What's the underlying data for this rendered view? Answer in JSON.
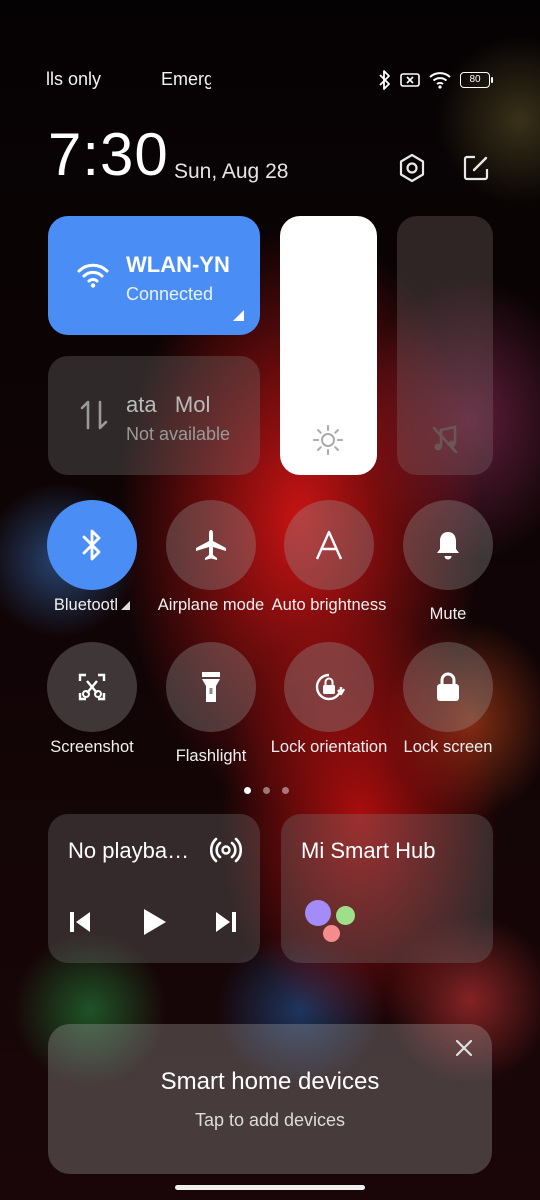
{
  "status_bar": {
    "operator_1": "lls only",
    "operator_2": "Emerg",
    "icons": [
      "bluetooth-icon",
      "no-sim-icon",
      "wifi-icon"
    ],
    "battery": "80"
  },
  "header": {
    "time": "7:30",
    "date": "Sun, Aug 28",
    "icons": [
      "settings-icon",
      "edit-icon"
    ]
  },
  "tiles": {
    "wifi": {
      "name": "WLAN-YN",
      "status": "Connected",
      "active": true,
      "icon": "wifi-icon"
    },
    "mobile_data": {
      "name": "ata   Mol",
      "status": "Not available",
      "active": false,
      "icon": "data-transfer-icon"
    },
    "brightness": {
      "icon": "sun-icon",
      "level": 1.0
    },
    "volume": {
      "icon": "music-muted-icon",
      "level": 0.0
    }
  },
  "toggles": [
    {
      "label": "Bluetootl",
      "icon": "bluetooth-icon",
      "active": true,
      "has_menu": true
    },
    {
      "label": "Airplane mode",
      "icon": "airplane-icon",
      "active": false
    },
    {
      "label": "Auto brightness",
      "icon": "letter-a-icon",
      "active": false
    },
    {
      "label": "Mute",
      "icon": "bell-icon",
      "active": false
    },
    {
      "label": "Screenshot",
      "icon": "scissors-screen-icon",
      "active": false
    },
    {
      "label": "Flashlight",
      "icon": "flashlight-icon",
      "active": false
    },
    {
      "label": "Lock orientation",
      "icon": "rotate-lock-icon",
      "active": false
    },
    {
      "label": "Lock screen",
      "icon": "padlock-icon",
      "active": false
    }
  ],
  "page_indicator": {
    "count": 3,
    "current": 0
  },
  "media": {
    "title": "No playba…",
    "icons": [
      "cast-icon",
      "previous-icon",
      "play-icon",
      "next-icon"
    ]
  },
  "hub": {
    "title": "Mi Smart Hub"
  },
  "smart_home": {
    "title": "Smart home devices",
    "subtitle": "Tap to add devices"
  },
  "colors": {
    "accent": "#4a8ef5",
    "tile_bg": "rgba(120,120,120,0.32)"
  }
}
